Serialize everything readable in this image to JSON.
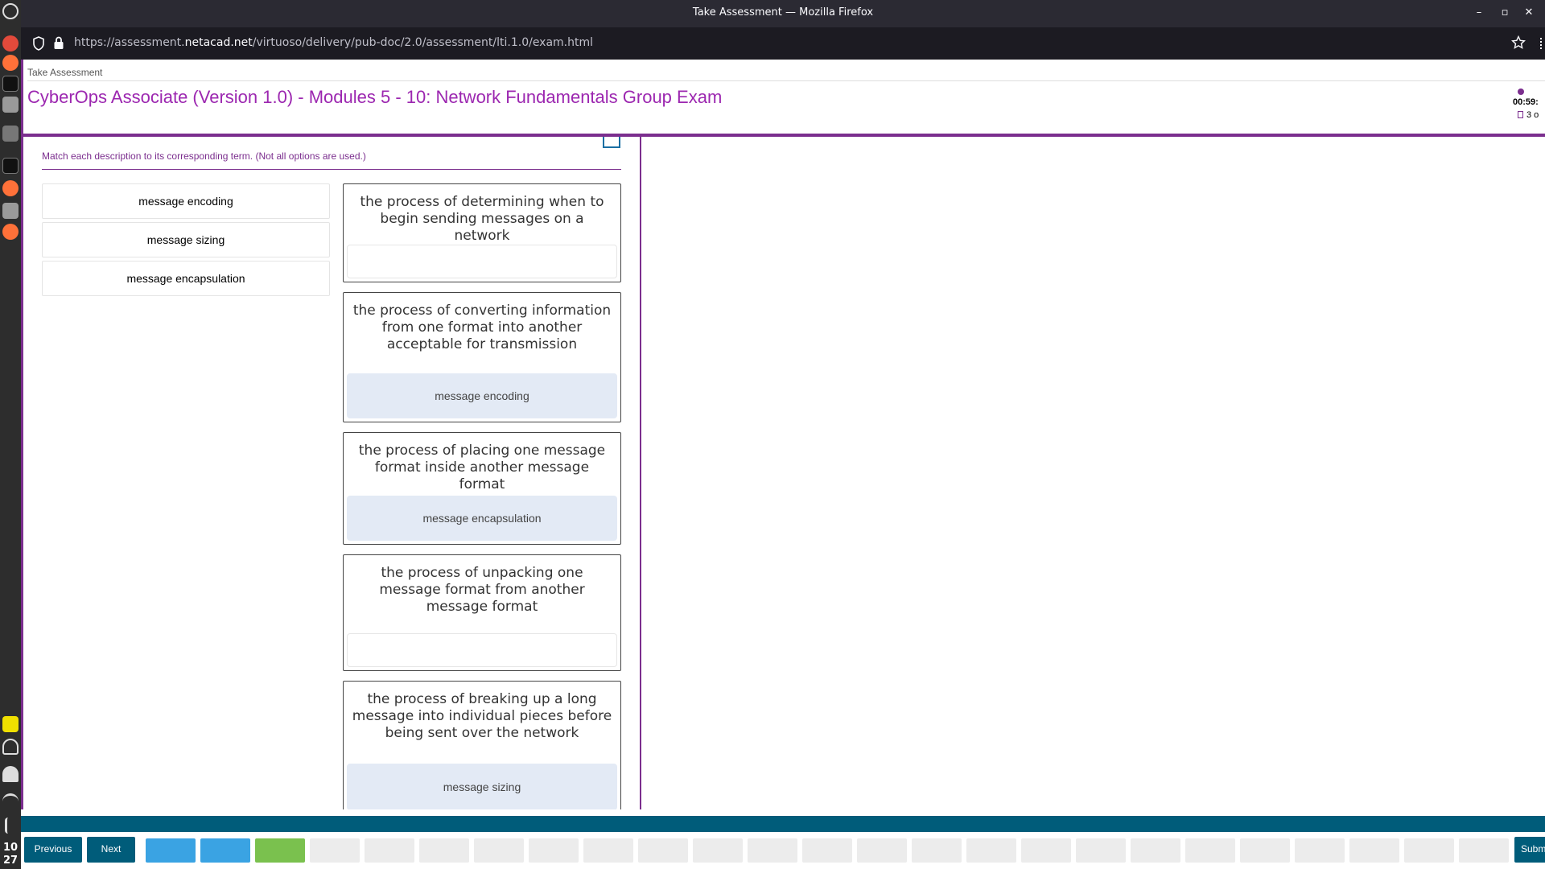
{
  "os": {
    "clock_hour": "10",
    "clock_minute": "27"
  },
  "browser": {
    "window_title": "Take Assessment — Mozilla Firefox",
    "url_prefix": "https://assessment.",
    "url_domain": "netacad.net",
    "url_path": "/virtuoso/delivery/pub-doc/2.0/assessment/lti.1.0/exam.html",
    "minimize": "–",
    "maximize": "▫",
    "close": "✕"
  },
  "header": {
    "breadcrumb": "Take Assessment",
    "exam_title": "CyberOps Associate (Version 1.0) - Modules 5 - 10: Network Fundamentals Group Exam",
    "timer": "00:59:",
    "question_count": "3 o"
  },
  "question": {
    "instruction": "Match each description to its corresponding term. (Not all options are used.)",
    "options": [
      "message encoding",
      "message sizing",
      "message encapsulation"
    ],
    "targets": [
      {
        "description": "the process of determining when to begin sending messages on a network",
        "answer": ""
      },
      {
        "description": "the process of converting information from one format into another acceptable for transmission",
        "answer": "message encoding"
      },
      {
        "description": "the process of placing one message format inside another message format",
        "answer": "message encapsulation"
      },
      {
        "description": "the process of unpacking one message format from another message format",
        "answer": ""
      },
      {
        "description": "the process of breaking up a long message into individual pieces before being sent over the network",
        "answer": "message sizing"
      }
    ]
  },
  "footer": {
    "previous_label": "Previous",
    "next_label": "Next",
    "submit_label": "Subm",
    "question_status_colors": {
      "answered": "#3aa3e3",
      "current": "#7ac14e",
      "unanswered": "#ececec"
    }
  },
  "colors": {
    "accent_purple": "#7b2e8e",
    "title_purple": "#9c27b0",
    "nav_teal": "#005c7a",
    "filled_drop": "#e3eaf5"
  }
}
